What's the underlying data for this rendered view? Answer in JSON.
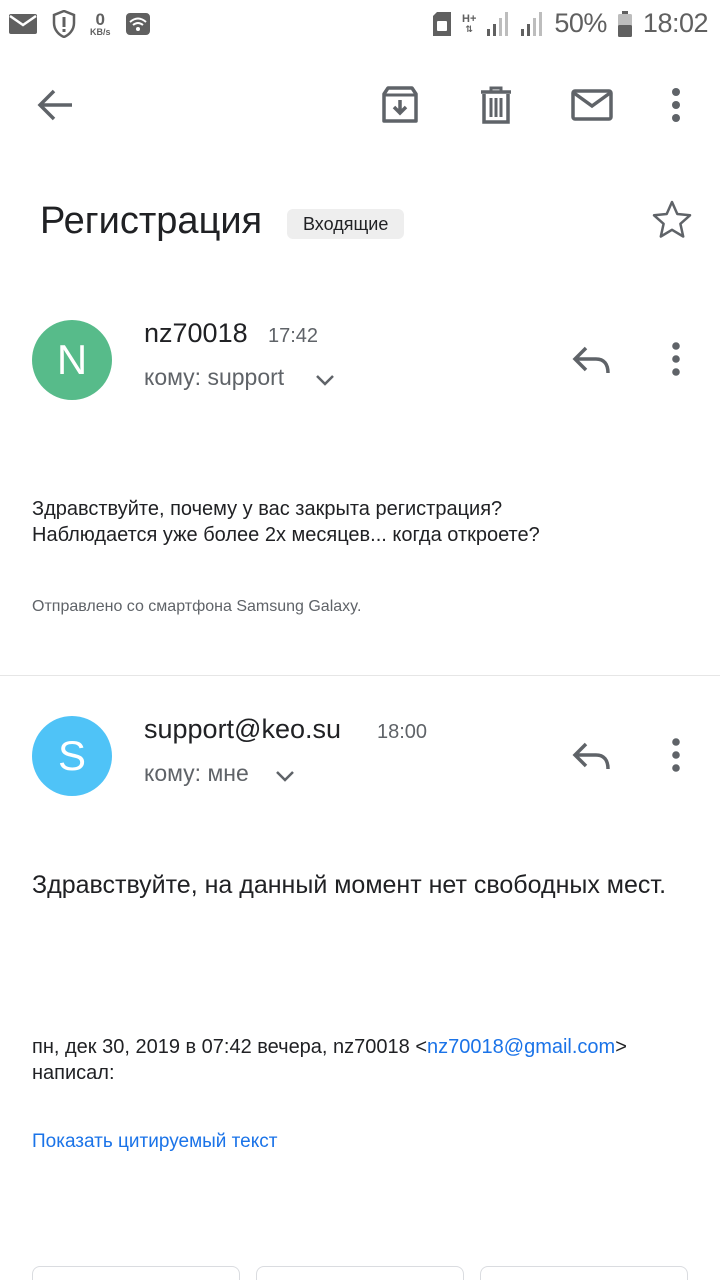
{
  "status_bar": {
    "speed_value": "0",
    "speed_unit": "KB/s",
    "network_type": "H+",
    "battery": "50%",
    "time": "18:02"
  },
  "email": {
    "subject": "Регистрация",
    "label": "Входящие"
  },
  "messages": [
    {
      "avatar_letter": "N",
      "avatar_color": "#57bb8a",
      "sender": "nz70018",
      "time": "17:42",
      "to": "кому: support",
      "body_line1": "Здравствуйте, почему у вас закрыта регистрация?",
      "body_line2": "Наблюдается уже более 2х месяцев... когда откроете?",
      "signature": "Отправлено со смартфона Samsung Galaxy."
    },
    {
      "avatar_letter": "S",
      "avatar_color": "#4fc3f7",
      "sender": "support@keo.su",
      "time": "18:00",
      "to": "кому: мне",
      "body": "Здравствуйте, на данный момент нет свободных мест.",
      "quote_prefix": "пн, дек 30, 2019 в 07:42 вечера, nz70018 <",
      "quote_email": "nz70018@gmail.com",
      "quote_suffix": "> написал:",
      "show_quoted": "Показать цитируемый текст"
    }
  ],
  "colors": {
    "icon": "#5f6368",
    "link": "#1a73e8"
  }
}
